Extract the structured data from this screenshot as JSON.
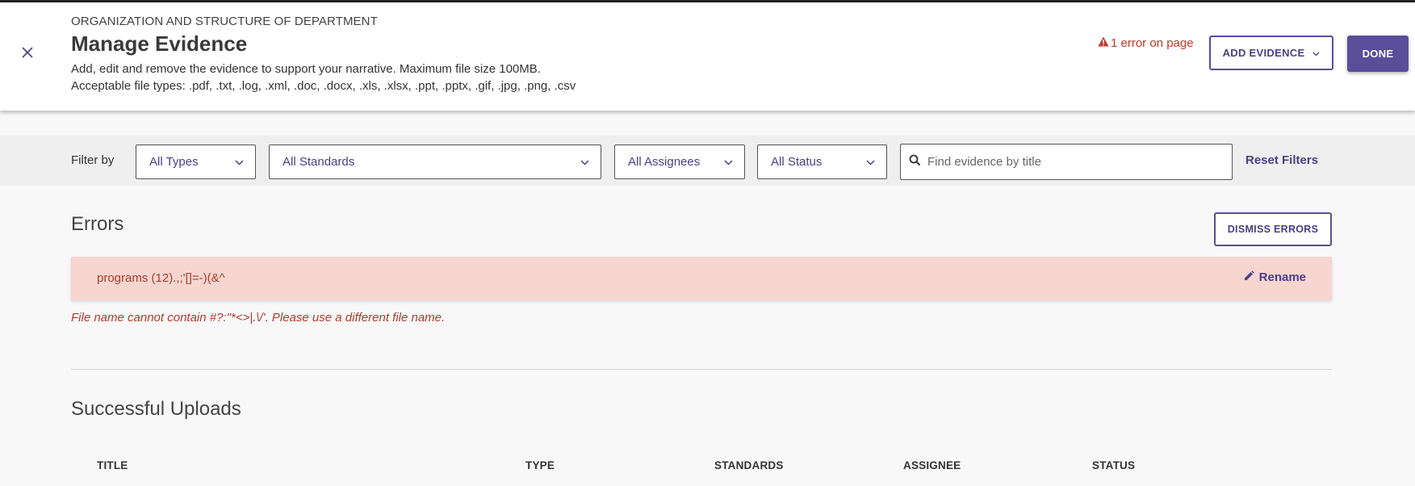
{
  "header": {
    "kicker": "ORGANIZATION AND STRUCTURE OF DEPARTMENT",
    "title": "Manage Evidence",
    "description_line1": "Add, edit and remove the evidence to support your narrative. Maximum file size 100MB.",
    "description_line2": "Acceptable file types: .pdf, .txt, .log, .xml, .doc, .docx, .xls, .xlsx, .ppt, .pptx, .gif, .jpg, .png, .csv",
    "error_count": "1 error on page",
    "add_evidence_label": "ADD EVIDENCE",
    "done_label": "DONE"
  },
  "filters": {
    "label": "Filter by",
    "types": "All Types",
    "standards": "All Standards",
    "assignees": "All Assignees",
    "status": "All Status",
    "search_placeholder": "Find evidence by title",
    "reset_label": "Reset Filters"
  },
  "errors": {
    "heading": "Errors",
    "dismiss_label": "DISMISS ERRORS",
    "items": [
      {
        "file_name": "programs (12).,;'[]=-)(&^",
        "action_label": "Rename",
        "message": "File name cannot contain #?:\"*<>|.\\/'. Please use a different file name."
      }
    ]
  },
  "uploads": {
    "heading": "Successful Uploads",
    "columns": [
      "TITLE",
      "TYPE",
      "STANDARDS",
      "ASSIGNEE",
      "STATUS"
    ]
  },
  "colors": {
    "accent": "#5a4d9a",
    "error_text": "#b03a2e",
    "error_bg": "#f6d6cf"
  },
  "icons": {
    "close": "close-icon",
    "warning": "warning-triangle-icon",
    "chevron": "chevron-down-icon",
    "search": "search-icon",
    "rename": "pencil-icon"
  }
}
